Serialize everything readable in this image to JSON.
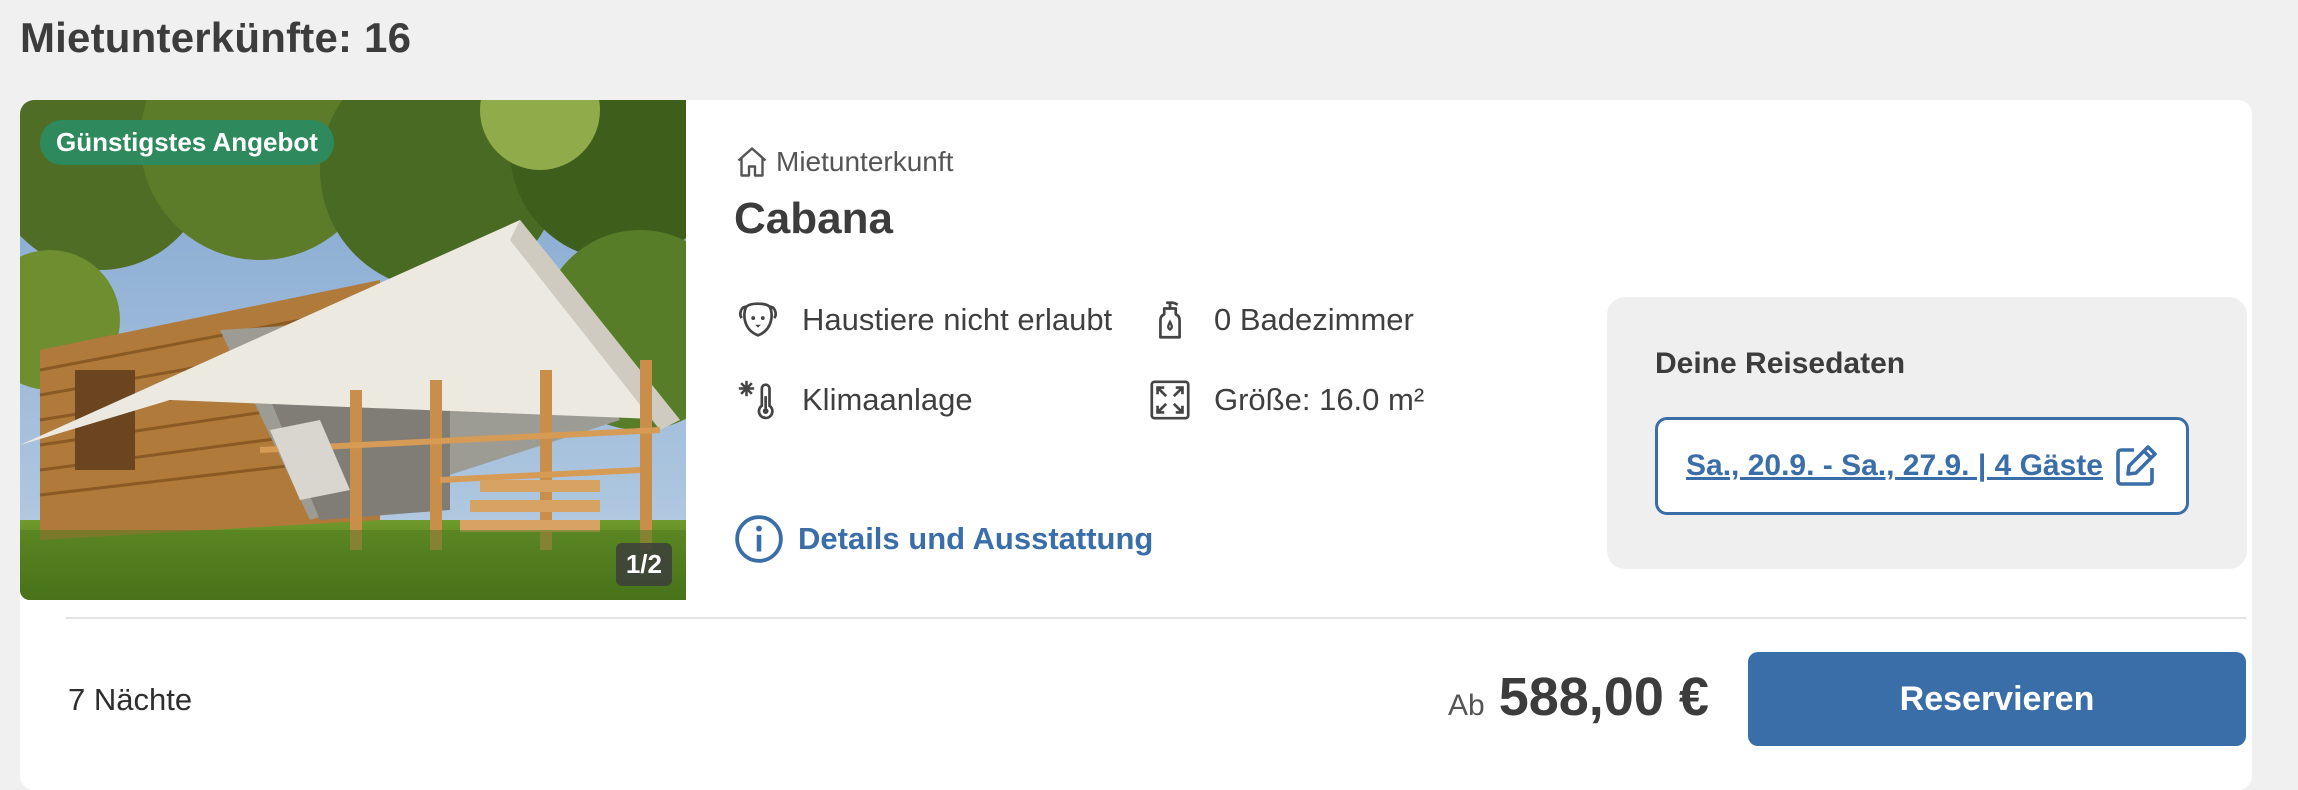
{
  "page": {
    "heading": "Mietunterkünfte: 16"
  },
  "listing": {
    "badge": "Günstigstes Angebot",
    "image_counter": "1/2",
    "type_label": "Mietunterkunft",
    "type_icon": "house-icon",
    "title": "Cabana",
    "features": [
      {
        "icon": "dog-icon",
        "label": "Haustiere nicht erlaubt"
      },
      {
        "icon": "soap-bottle-icon",
        "label": "0 Badezimmer"
      },
      {
        "icon": "snowflake-thermometer-icon",
        "label": "Klimaanlage"
      },
      {
        "icon": "expand-icon",
        "label": "Größe: 16.0 m²"
      }
    ],
    "details_link": "Details und Ausstattung",
    "nights": "7 Nächte",
    "price_prefix": "Ab",
    "price": "588,00 €",
    "reserve_label": "Reservieren"
  },
  "travel_dates": {
    "title": "Deine Reisedaten",
    "value": "Sa., 20.9. - Sa., 27.9. | 4 Gäste",
    "edit_icon": "edit-icon"
  },
  "colors": {
    "accent_blue": "#3a6ea8",
    "badge_green": "#2e8a5c",
    "background": "#f0f0f0"
  }
}
